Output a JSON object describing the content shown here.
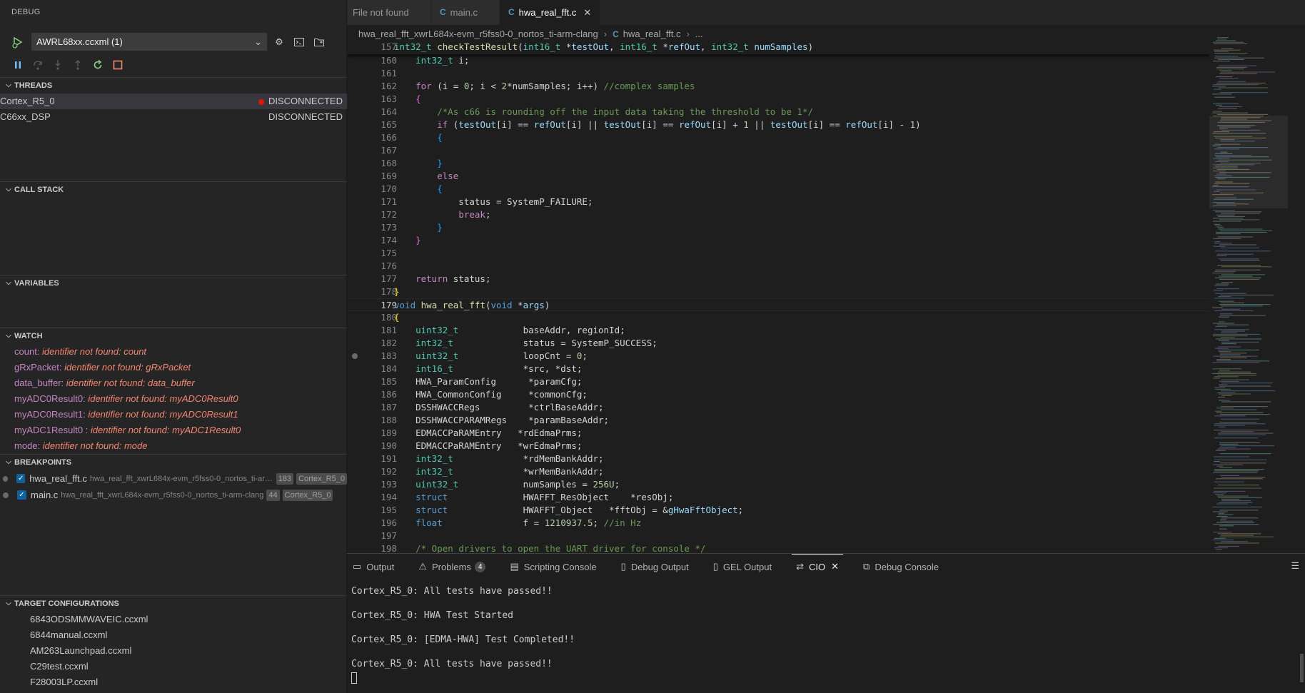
{
  "sidebar": {
    "title": "DEBUG",
    "launch_config": "AWRL68xx.ccxml (1)",
    "threads": {
      "header": "THREADS",
      "items": [
        {
          "name": "Cortex_R5_0",
          "status": "DISCONNECTED"
        },
        {
          "name": "C66xx_DSP",
          "status": "DISCONNECTED"
        }
      ]
    },
    "call_stack_header": "CALL STACK",
    "variables_header": "VARIABLES",
    "watch": {
      "header": "WATCH",
      "items": [
        {
          "name": "count:",
          "value": "identifier not found: count"
        },
        {
          "name": "gRxPacket:",
          "value": "identifier not found: gRxPacket"
        },
        {
          "name": "data_buffer:",
          "value": "identifier not found: data_buffer"
        },
        {
          "name": "myADC0Result0:",
          "value": "identifier not found: myADC0Result0"
        },
        {
          "name": "myADC0Result1:",
          "value": "identifier not found: myADC0Result1"
        },
        {
          "name": "myADC1Result0 :",
          "value": "identifier not found: myADC1Result0"
        },
        {
          "name": "mode:",
          "value": "identifier not found: mode"
        }
      ]
    },
    "breakpoints": {
      "header": "BREAKPOINTS",
      "items": [
        {
          "file": "hwa_real_fft.c",
          "path": "hwa_real_fft_xwrL684x-evm_r5fss0-0_nortos_ti-arm-cla...",
          "line": "183",
          "core": "Cortex_R5_0"
        },
        {
          "file": "main.c",
          "path": "hwa_real_fft_xwrL684x-evm_r5fss0-0_nortos_ti-arm-clang",
          "line": "44",
          "core": "Cortex_R5_0"
        }
      ]
    },
    "target_configs": {
      "header": "TARGET CONFIGURATIONS",
      "items": [
        "6843ODSMMWAVEIC.ccxml",
        "6844manual.ccxml",
        "AM263Launchpad.ccxml",
        "C29test.ccxml",
        "F28003LP.ccxml"
      ]
    }
  },
  "editor": {
    "tabs": [
      {
        "label": "File not found",
        "icon": "none"
      },
      {
        "label": "main.c",
        "icon": "c-file-icon"
      },
      {
        "label": "hwa_real_fft.c",
        "icon": "c-file-icon"
      }
    ],
    "breadcrumb": [
      "hwa_real_fft_xwrL684x-evm_r5fss0-0_nortos_ti-arm-clang",
      "hwa_real_fft.c",
      "..."
    ],
    "current_line": "179",
    "breakpoint_line": "183",
    "lines": [
      {
        "n": "157",
        "t": [
          [
            "int32_t",
            "ty"
          ],
          [
            " "
          ],
          [
            "checkTestResult",
            "fn"
          ],
          [
            "("
          ],
          [
            "int16_t",
            "ty"
          ],
          [
            " *"
          ],
          [
            "testOut",
            "vr"
          ],
          [
            ", "
          ],
          [
            "int16_t",
            "ty"
          ],
          [
            " *"
          ],
          [
            "refOut",
            "vr"
          ],
          [
            ", "
          ],
          [
            "int32_t",
            "ty"
          ],
          [
            " "
          ],
          [
            "numSamples",
            "vr"
          ],
          [
            ")"
          ]
        ]
      },
      {
        "n": "160",
        "t": [
          [
            "    "
          ],
          [
            "int32_t",
            "ty"
          ],
          [
            " i;"
          ]
        ]
      },
      {
        "n": "161",
        "t": [
          [
            ""
          ]
        ]
      },
      {
        "n": "162",
        "t": [
          [
            "    "
          ],
          [
            "for",
            "kc"
          ],
          [
            " ("
          ],
          [
            "i = "
          ],
          [
            "0",
            "nu"
          ],
          [
            "; i < "
          ],
          [
            "2",
            "nu"
          ],
          [
            "*numSamples; i++) "
          ],
          [
            "//complex samples",
            "cm"
          ]
        ]
      },
      {
        "n": "163",
        "t": [
          [
            "    "
          ],
          [
            "{",
            "br2"
          ]
        ]
      },
      {
        "n": "164",
        "t": [
          [
            "        "
          ],
          [
            "/*As c66 is rounding off the input data taking the threshold to be 1*/",
            "cm"
          ]
        ]
      },
      {
        "n": "165",
        "t": [
          [
            "        "
          ],
          [
            "if",
            "kc"
          ],
          [
            " ("
          ],
          [
            "testOut",
            "vr"
          ],
          [
            "[i] == "
          ],
          [
            "refOut",
            "vr"
          ],
          [
            "[i] || "
          ],
          [
            "testOut",
            "vr"
          ],
          [
            "[i] == "
          ],
          [
            "refOut",
            "vr"
          ],
          [
            "[i] + "
          ],
          [
            "1",
            "nu"
          ],
          [
            " || "
          ],
          [
            "testOut",
            "vr"
          ],
          [
            "[i] == "
          ],
          [
            "refOut",
            "vr"
          ],
          [
            "[i] - "
          ],
          [
            "1",
            "nu"
          ],
          [
            ")"
          ]
        ]
      },
      {
        "n": "166",
        "t": [
          [
            "        "
          ],
          [
            "{",
            "br3"
          ]
        ]
      },
      {
        "n": "167",
        "t": [
          [
            ""
          ]
        ]
      },
      {
        "n": "168",
        "t": [
          [
            "        "
          ],
          [
            "}",
            "br3"
          ]
        ]
      },
      {
        "n": "169",
        "t": [
          [
            "        "
          ],
          [
            "else",
            "kc"
          ]
        ]
      },
      {
        "n": "170",
        "t": [
          [
            "        "
          ],
          [
            "{",
            "br3"
          ]
        ]
      },
      {
        "n": "171",
        "t": [
          [
            "            status = SystemP_FAILURE;"
          ]
        ]
      },
      {
        "n": "172",
        "t": [
          [
            "            "
          ],
          [
            "break",
            "kc"
          ],
          [
            ";"
          ]
        ]
      },
      {
        "n": "173",
        "t": [
          [
            "        "
          ],
          [
            "}",
            "br3"
          ]
        ]
      },
      {
        "n": "174",
        "t": [
          [
            "    "
          ],
          [
            "}",
            "br2"
          ]
        ]
      },
      {
        "n": "175",
        "t": [
          [
            ""
          ]
        ]
      },
      {
        "n": "176",
        "t": [
          [
            ""
          ]
        ]
      },
      {
        "n": "177",
        "t": [
          [
            "    "
          ],
          [
            "return",
            "kc"
          ],
          [
            " status;"
          ]
        ]
      },
      {
        "n": "178",
        "t": [
          [
            "}",
            "br"
          ]
        ]
      },
      {
        "n": "179",
        "t": [
          [
            "void",
            "k"
          ],
          [
            " "
          ],
          [
            "hwa_real_fft",
            "fn"
          ],
          [
            "("
          ],
          [
            "void",
            "k"
          ],
          [
            " *"
          ],
          [
            "args",
            "vr"
          ],
          [
            ")"
          ]
        ]
      },
      {
        "n": "180",
        "t": [
          [
            "{",
            "br"
          ]
        ]
      },
      {
        "n": "181",
        "t": [
          [
            "    "
          ],
          [
            "uint32_t",
            "ty"
          ],
          [
            "            baseAddr, regionId;"
          ]
        ]
      },
      {
        "n": "182",
        "t": [
          [
            "    "
          ],
          [
            "int32_t",
            "ty"
          ],
          [
            "             status = SystemP_SUCCESS;"
          ]
        ]
      },
      {
        "n": "183",
        "t": [
          [
            "    "
          ],
          [
            "uint32_t",
            "ty"
          ],
          [
            "            loopCnt = "
          ],
          [
            "0",
            "nu"
          ],
          [
            ";"
          ]
        ]
      },
      {
        "n": "184",
        "t": [
          [
            "    "
          ],
          [
            "int16_t",
            "ty"
          ],
          [
            "             *src, *dst;"
          ]
        ]
      },
      {
        "n": "185",
        "t": [
          [
            "    HWA_ParamConfig      *paramCfg;"
          ]
        ]
      },
      {
        "n": "186",
        "t": [
          [
            "    HWA_CommonConfig     *commonCfg;"
          ]
        ]
      },
      {
        "n": "187",
        "t": [
          [
            "    DSSHWACCRegs         *ctrlBaseAddr;"
          ]
        ]
      },
      {
        "n": "188",
        "t": [
          [
            "    DSSHWACCPARAMRegs    *paramBaseAddr;"
          ]
        ]
      },
      {
        "n": "189",
        "t": [
          [
            "    EDMACCPaRAMEntry   *rdEdmaPrms;"
          ]
        ]
      },
      {
        "n": "190",
        "t": [
          [
            "    EDMACCPaRAMEntry   *wrEdmaPrms;"
          ]
        ]
      },
      {
        "n": "191",
        "t": [
          [
            "    "
          ],
          [
            "int32_t",
            "ty"
          ],
          [
            "             *rdMemBankAddr;"
          ]
        ]
      },
      {
        "n": "192",
        "t": [
          [
            "    "
          ],
          [
            "int32_t",
            "ty"
          ],
          [
            "             *wrMemBankAddr;"
          ]
        ]
      },
      {
        "n": "193",
        "t": [
          [
            "    "
          ],
          [
            "uint32_t",
            "ty"
          ],
          [
            "            numSamples = "
          ],
          [
            "256U",
            "nu"
          ],
          [
            ";"
          ]
        ]
      },
      {
        "n": "194",
        "t": [
          [
            "    "
          ],
          [
            "struct",
            "k"
          ],
          [
            "              HWAFFT_ResObject    *resObj;"
          ]
        ]
      },
      {
        "n": "195",
        "t": [
          [
            "    "
          ],
          [
            "struct",
            "k"
          ],
          [
            "              HWAFFT_Object   *fftObj = &"
          ],
          [
            "gHwaFftObject",
            "vr"
          ],
          [
            ";"
          ]
        ]
      },
      {
        "n": "196",
        "t": [
          [
            "    "
          ],
          [
            "float",
            "k"
          ],
          [
            "               f = "
          ],
          [
            "1210937.5",
            "nu"
          ],
          [
            "; "
          ],
          [
            "//in Hz",
            "cm"
          ]
        ]
      },
      {
        "n": "197",
        "t": [
          [
            ""
          ]
        ]
      },
      {
        "n": "198",
        "t": [
          [
            "    "
          ],
          [
            "/* Open drivers to open the UART driver for console */",
            "cm"
          ]
        ]
      }
    ]
  },
  "panel": {
    "tabs": [
      {
        "label": "Output",
        "icon": "output-icon"
      },
      {
        "label": "Problems",
        "icon": "warning-icon",
        "badge": "4"
      },
      {
        "label": "Scripting Console",
        "icon": "console-icon"
      },
      {
        "label": "Debug Output",
        "icon": "file-icon"
      },
      {
        "label": "GEL Output",
        "icon": "file-icon"
      },
      {
        "label": "CIO",
        "icon": "transfer-icon"
      },
      {
        "label": "Debug Console",
        "icon": "debug-console-icon"
      }
    ],
    "cio_lines": [
      "Cortex_R5_0: All tests have passed!!",
      "Cortex_R5_0: HWA Test Started",
      "Cortex_R5_0: [EDMA-HWA] Test Completed!!",
      "Cortex_R5_0: All tests have passed!!"
    ]
  }
}
